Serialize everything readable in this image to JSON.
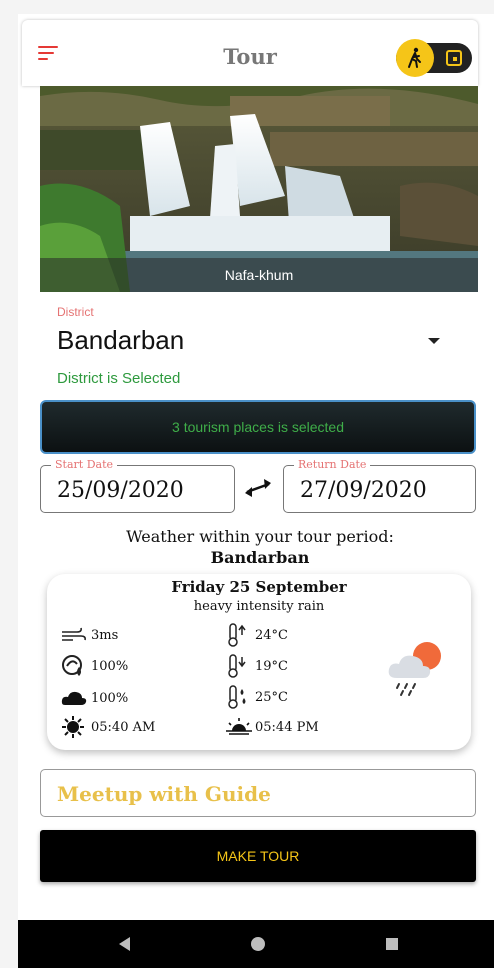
{
  "app": {
    "title": "Tour"
  },
  "hero": {
    "caption": "Nafa-khum"
  },
  "district": {
    "label": "District",
    "value": "Bandarban",
    "status": "District is Selected"
  },
  "places": {
    "label": "3 tourism places is selected"
  },
  "dates": {
    "start": {
      "label": "Start Date",
      "value": "25/09/2020"
    },
    "return": {
      "label": "Return Date",
      "value": "27/09/2020"
    }
  },
  "weather": {
    "heading": "Weather within your tour period:",
    "location": "Bandarban",
    "day": "Friday 25 September",
    "description": "heavy intensity rain",
    "wind": "3ms",
    "humidity": "100%",
    "clouds": "100%",
    "sunrise": "05:40 AM",
    "temp_max": "24°C",
    "temp_min": "19°C",
    "feels_like": "25°C",
    "sunset": "05:44 PM"
  },
  "meetup": {
    "label": "Meetup with Guide"
  },
  "actions": {
    "make_tour": "MAKE TOUR"
  },
  "icons": {
    "menu": "menu-icon",
    "walk": "walking-icon",
    "calendar": "calendar-icon",
    "swap": "swap-arrows-icon",
    "wind": "wind-icon",
    "humidity": "humidity-icon",
    "cloud": "cloud-icon",
    "sunrise": "sunrise-icon",
    "temp_up": "thermometer-up-icon",
    "temp_down": "thermometer-down-icon",
    "feels": "thermometer-drop-icon",
    "sunset": "sunset-icon",
    "weather": "rain-cloud-sun-icon"
  },
  "colors": {
    "accent": "#f5c518",
    "menu": "#e53935",
    "district_label": "#e57373",
    "status_green": "#2e9a3e"
  }
}
